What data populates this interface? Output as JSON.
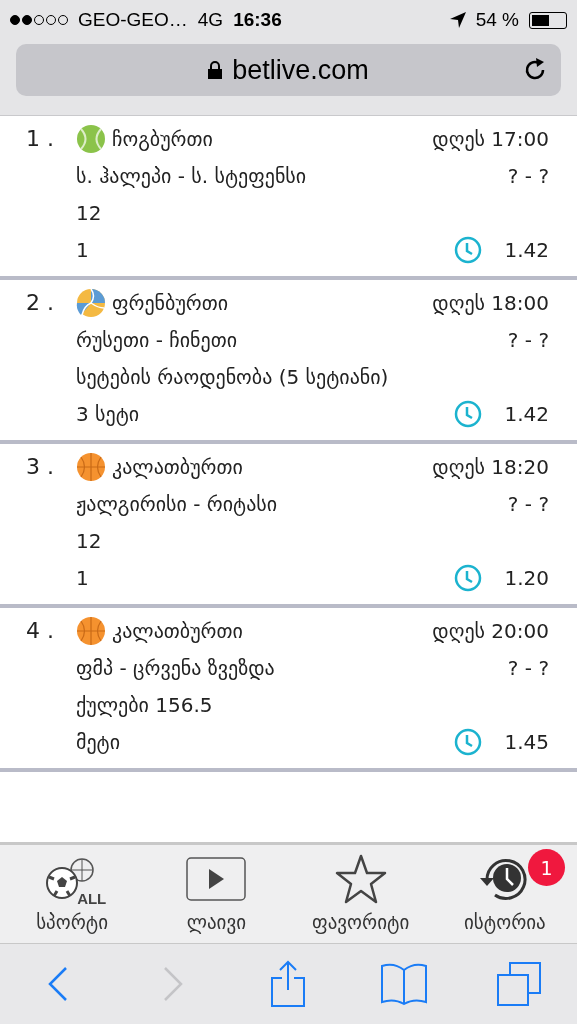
{
  "status_bar": {
    "carrier": "GEO-GEO…",
    "network": "4G",
    "time": "16:36",
    "battery_text": "54 %"
  },
  "address_bar": {
    "url": "betlive.com"
  },
  "events": [
    {
      "number": "1 .",
      "kind": "tennis",
      "sport": "ჩოგბურთი",
      "time": "დღეს 17:00",
      "match": "ს. ჰალეპი - ს. სტეფენსი",
      "score": "? - ?",
      "market": "12",
      "pick": "1",
      "odds": "1.42"
    },
    {
      "number": "2 .",
      "kind": "volleyball",
      "sport": "ფრენბურთი",
      "time": "დღეს 18:00",
      "match": "რუსეთი - ჩინეთი",
      "score": "? - ?",
      "market": "სეტების რაოდენობა (5 სეტიანი)",
      "pick": "3 სეტი",
      "odds": "1.42"
    },
    {
      "number": "3 .",
      "kind": "basketball",
      "sport": "კალათბურთი",
      "time": "დღეს 18:20",
      "match": "ჟალგირისი - რიტასი",
      "score": "? - ?",
      "market": "12",
      "pick": "1",
      "odds": "1.20"
    },
    {
      "number": "4 .",
      "kind": "basketball",
      "sport": "კალათბურთი",
      "time": "დღეს 20:00",
      "match": "ფმპ - ცრვენა ზვეზდა",
      "score": "? - ?",
      "market": "ქულები 156.5",
      "pick": "მეტი",
      "odds": "1.45"
    }
  ],
  "tab_bar": [
    {
      "kind": "sports",
      "label": "სპორტი",
      "icon_text": "ALL"
    },
    {
      "kind": "live",
      "label": "ლაივი"
    },
    {
      "kind": "favorites",
      "label": "ფავორიტი"
    },
    {
      "kind": "history",
      "label": "ისტორია",
      "badge": "1"
    }
  ],
  "browser_toolbar": {
    "forward_disabled": true
  }
}
